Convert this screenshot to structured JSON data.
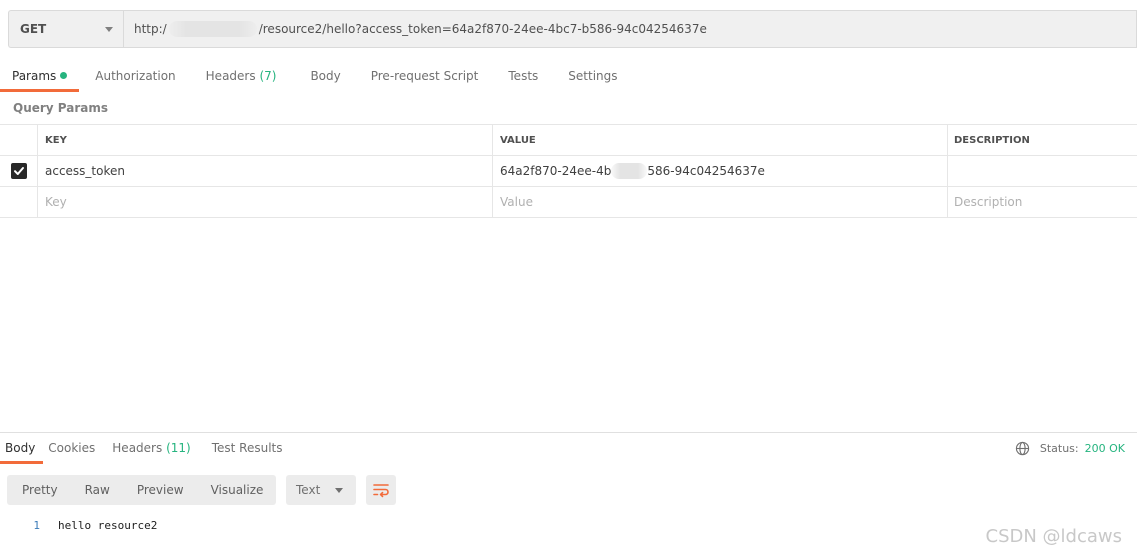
{
  "request": {
    "method": "GET",
    "url_prefix": "http:/",
    "url_suffix": "/resource2/hello?access_token=64a2f870-24ee-4bc7-b586-94c04254637e"
  },
  "request_tabs": [
    {
      "label": "Params",
      "active": true,
      "has_dot": true
    },
    {
      "label": "Authorization"
    },
    {
      "label": "Headers",
      "count": "(7)"
    },
    {
      "label": "Body"
    },
    {
      "label": "Pre-request Script"
    },
    {
      "label": "Tests"
    },
    {
      "label": "Settings"
    }
  ],
  "query_params": {
    "title": "Query Params",
    "columns": [
      "KEY",
      "VALUE",
      "DESCRIPTION"
    ],
    "rows": [
      {
        "checked": true,
        "key": "access_token",
        "value_prefix": "64a2f870-24ee-4b",
        "value_suffix": "586-94c04254637e",
        "description": ""
      }
    ],
    "placeholder": {
      "key": "Key",
      "value": "Value",
      "description": "Description"
    }
  },
  "response": {
    "tabs": [
      {
        "label": "Body",
        "active": true
      },
      {
        "label": "Cookies"
      },
      {
        "label": "Headers",
        "count": "(11)"
      },
      {
        "label": "Test Results"
      }
    ],
    "status_label": "Status:",
    "status_value": "200 OK",
    "view_modes": [
      "Pretty",
      "Raw",
      "Preview",
      "Visualize"
    ],
    "format": "Text",
    "lines": [
      {
        "number": "1",
        "text": "hello resource2"
      }
    ]
  },
  "watermark": "CSDN @ldcaws",
  "colors": {
    "accent": "#f26b3a",
    "success": "#26b47f"
  }
}
